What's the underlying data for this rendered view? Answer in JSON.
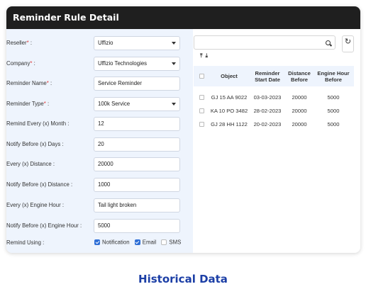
{
  "header": {
    "title": "Reminder Rule Detail"
  },
  "form": {
    "reseller": {
      "label": "Reseller",
      "value": "Uffizio"
    },
    "company": {
      "label": "Company",
      "value": "Uffizio Technologies"
    },
    "reminder_name": {
      "label": "Reminder Name",
      "value": "Service Reminder"
    },
    "reminder_type": {
      "label": "Reminder Type",
      "value": "100k Service"
    },
    "remind_every_month": {
      "label": "Remind Every (x) Month :",
      "value": "12"
    },
    "notify_before_days": {
      "label": "Notify Before (x) Days :",
      "value": "20"
    },
    "every_distance": {
      "label": "Every (x) Distance :",
      "value": "20000"
    },
    "notify_before_distance": {
      "label": "Notify Before (x) Distance :",
      "value": "1000"
    },
    "every_engine_hour": {
      "label": "Every (x) Engine Hour :",
      "value": "Tail light broken"
    },
    "notify_before_engine_hour": {
      "label": "Notify Before (x) Engine Hour :",
      "value": "5000"
    },
    "remind_using": {
      "label": "Remind Using :",
      "options": [
        {
          "label": "Notification",
          "checked": true
        },
        {
          "label": "Email",
          "checked": true
        },
        {
          "label": "SMS",
          "checked": false
        }
      ]
    },
    "required_mark": "*",
    "colon": " :"
  },
  "table": {
    "headers": {
      "object": "Object",
      "start_date": "Reminder Start Date",
      "distance": "Distance Before",
      "engine_hour": "Engine Hour Before"
    },
    "rows": [
      {
        "object": "GJ 15 AA 9022",
        "start_date": "03-03-2023",
        "distance": "20000",
        "engine_hour": "5000"
      },
      {
        "object": "KA 10 PO 3482",
        "start_date": "28-02-2023",
        "distance": "20000",
        "engine_hour": "5000"
      },
      {
        "object": "GJ 28 HH 1122",
        "start_date": "20-02-2023",
        "distance": "20000",
        "engine_hour": "5000"
      }
    ]
  },
  "icons": {
    "search": "search-icon",
    "refresh": "refresh-icon",
    "upload": "upload-icon",
    "download": "download-icon"
  },
  "colors": {
    "header_bg": "#1f1f1f",
    "panel_bg": "#eef4fd",
    "accent": "#2f6fd6",
    "required": "#e23b3b",
    "caption": "#1c3fa6"
  },
  "caption": "Historical Data"
}
